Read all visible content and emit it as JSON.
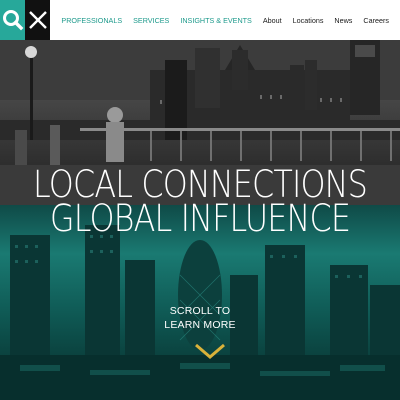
{
  "header": {
    "search_icon": "search-icon",
    "close_icon": "close-icon",
    "nav": [
      {
        "label": "PROFESSIONALS"
      },
      {
        "label": "SERVICES"
      },
      {
        "label": "INSIGHTS & EVENTS"
      },
      {
        "label": "About"
      },
      {
        "label": "Locations"
      },
      {
        "label": "News"
      },
      {
        "label": "Careers"
      }
    ]
  },
  "hero": {
    "line1": "LOCAL CONNECTIONS",
    "line2": "GLOBAL INFLUENCE",
    "scroll_line1": "SCROLL TO",
    "scroll_line2": "LEARN MORE",
    "scroll_icon": "chevron-down-icon"
  },
  "colors": {
    "accent": "#27a89a",
    "nav_accent": "#1e9a8c",
    "close_bg": "#111111"
  }
}
